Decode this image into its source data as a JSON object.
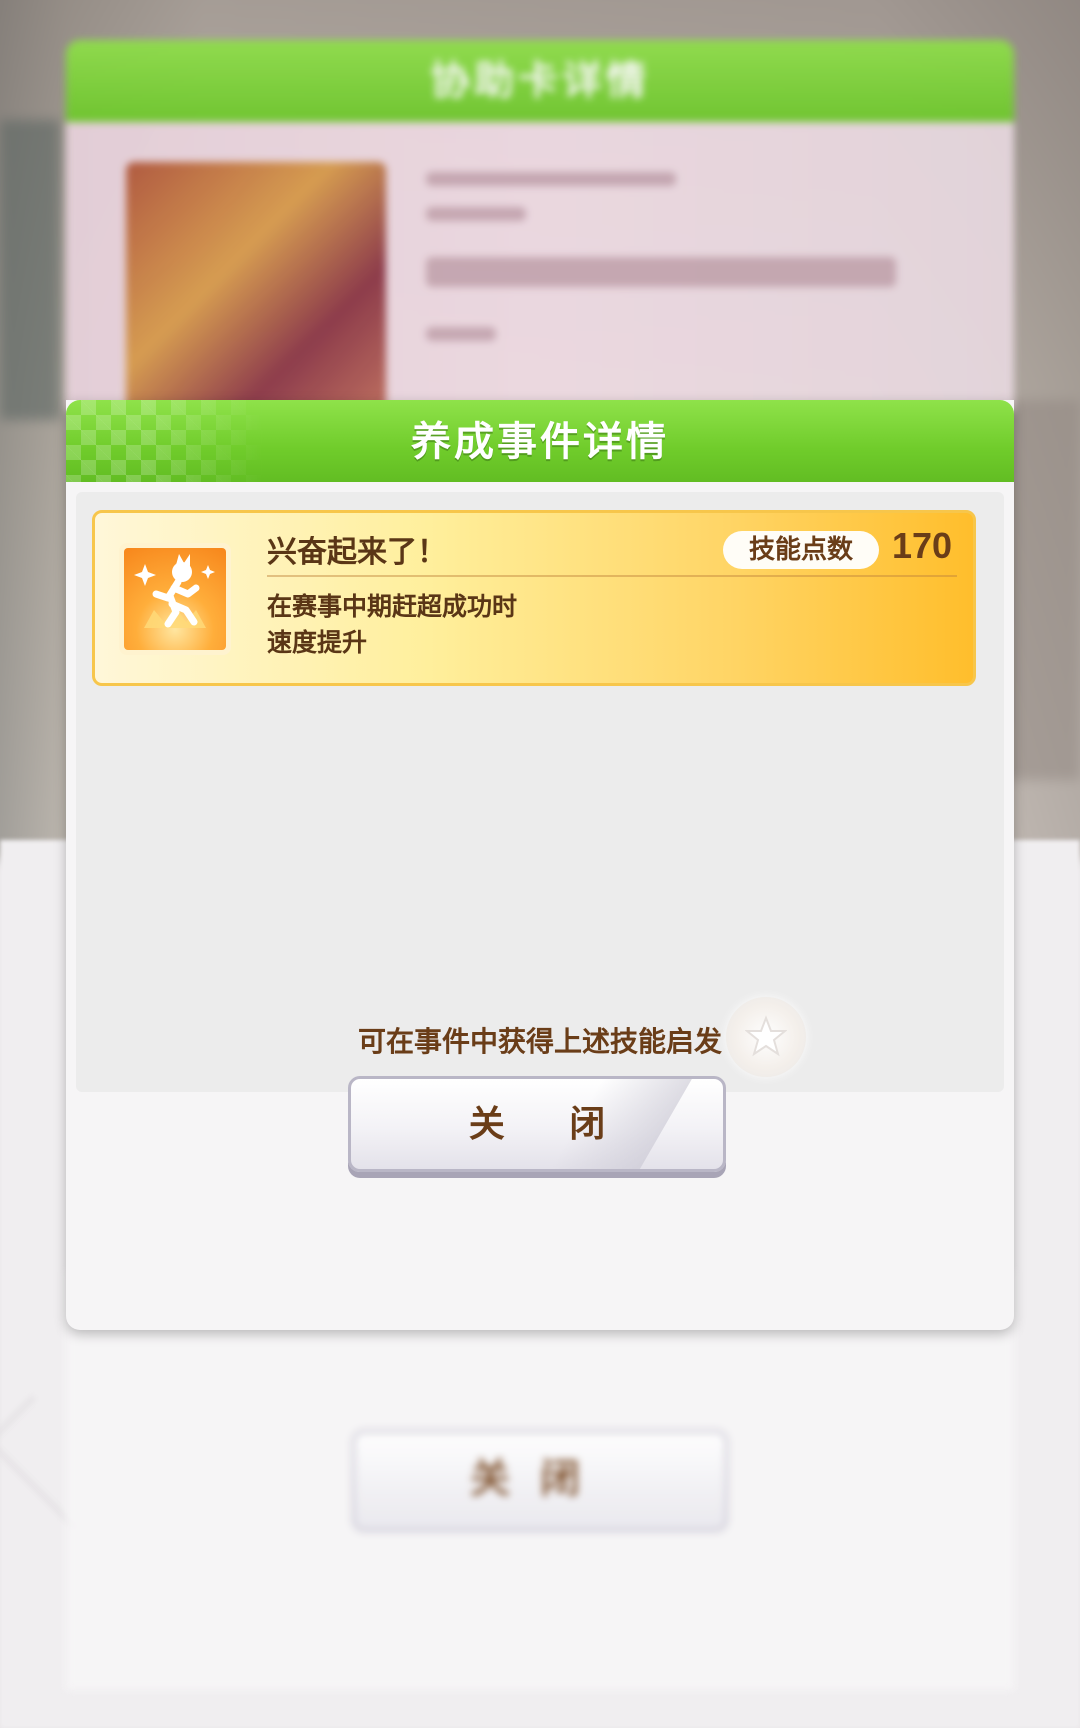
{
  "background": {
    "panel_title": "协助卡详情",
    "close_label": "关闭"
  },
  "dialog": {
    "title": "养成事件详情",
    "skill": {
      "name": "兴奋起来了！",
      "points_label": "技能点数",
      "points_value": "170",
      "description": [
        "在赛事中期赶超成功时",
        "速度提升"
      ],
      "icon": "running-figure-icon"
    },
    "hint_icon": "star-icon",
    "footer_text": "可在事件中获得上述技能启发",
    "close_label": "关 闭"
  },
  "colors": {
    "header_green": "#70cc2b",
    "card_gold": "#ffbe2c",
    "text_brown": "#6a3d18"
  }
}
